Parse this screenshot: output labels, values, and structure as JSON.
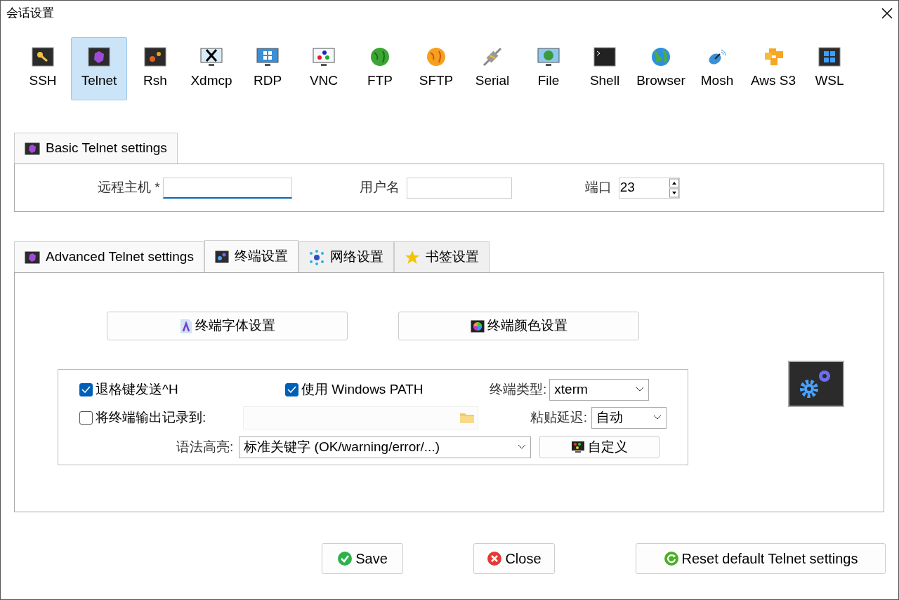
{
  "window": {
    "title": "会话设置"
  },
  "session_types": [
    {
      "label": "SSH",
      "selected": false
    },
    {
      "label": "Telnet",
      "selected": true
    },
    {
      "label": "Rsh",
      "selected": false
    },
    {
      "label": "Xdmcp",
      "selected": false
    },
    {
      "label": "RDP",
      "selected": false
    },
    {
      "label": "VNC",
      "selected": false
    },
    {
      "label": "FTP",
      "selected": false
    },
    {
      "label": "SFTP",
      "selected": false
    },
    {
      "label": "Serial",
      "selected": false
    },
    {
      "label": "File",
      "selected": false
    },
    {
      "label": "Shell",
      "selected": false
    },
    {
      "label": "Browser",
      "selected": false
    },
    {
      "label": "Mosh",
      "selected": false
    },
    {
      "label": "Aws S3",
      "selected": false
    },
    {
      "label": "WSL",
      "selected": false
    }
  ],
  "basic_settings": {
    "tab": "Basic Telnet settings",
    "remote_host": {
      "label": "远程主机 *",
      "focused": true
    },
    "username": {
      "label": "用户名"
    },
    "port": {
      "label": "端口",
      "value": "23"
    }
  },
  "advanced_tabs": [
    {
      "label": "Advanced Telnet settings",
      "selected": false
    },
    {
      "label": "终端设置",
      "selected": true
    },
    {
      "label": "网络设置",
      "selected": false
    },
    {
      "label": "书签设置",
      "selected": false
    }
  ],
  "terminal": {
    "buttons": [
      "终端字体设置",
      "终端颜色设置"
    ],
    "backspace": {
      "label": "退格键发送^H",
      "checked": true
    },
    "windows_path": {
      "label": "使用 Windows PATH",
      "checked": true
    },
    "terminal_type": {
      "label": "终端类型:",
      "value": "xterm"
    },
    "log_output": {
      "label": "将终端输出记录到:",
      "checked": false
    },
    "paste_delay": {
      "label": "粘贴延迟:",
      "value": "自动"
    },
    "syntax": {
      "label": "语法高亮:",
      "value": "标准关键字 (OK/warning/error/...)"
    },
    "custom_button": "自定义"
  },
  "footer_buttons": [
    {
      "label": "Save",
      "kind": "save"
    },
    {
      "label": "Close",
      "kind": "close"
    },
    {
      "label": "Reset default Telnet settings",
      "kind": "reset"
    }
  ]
}
